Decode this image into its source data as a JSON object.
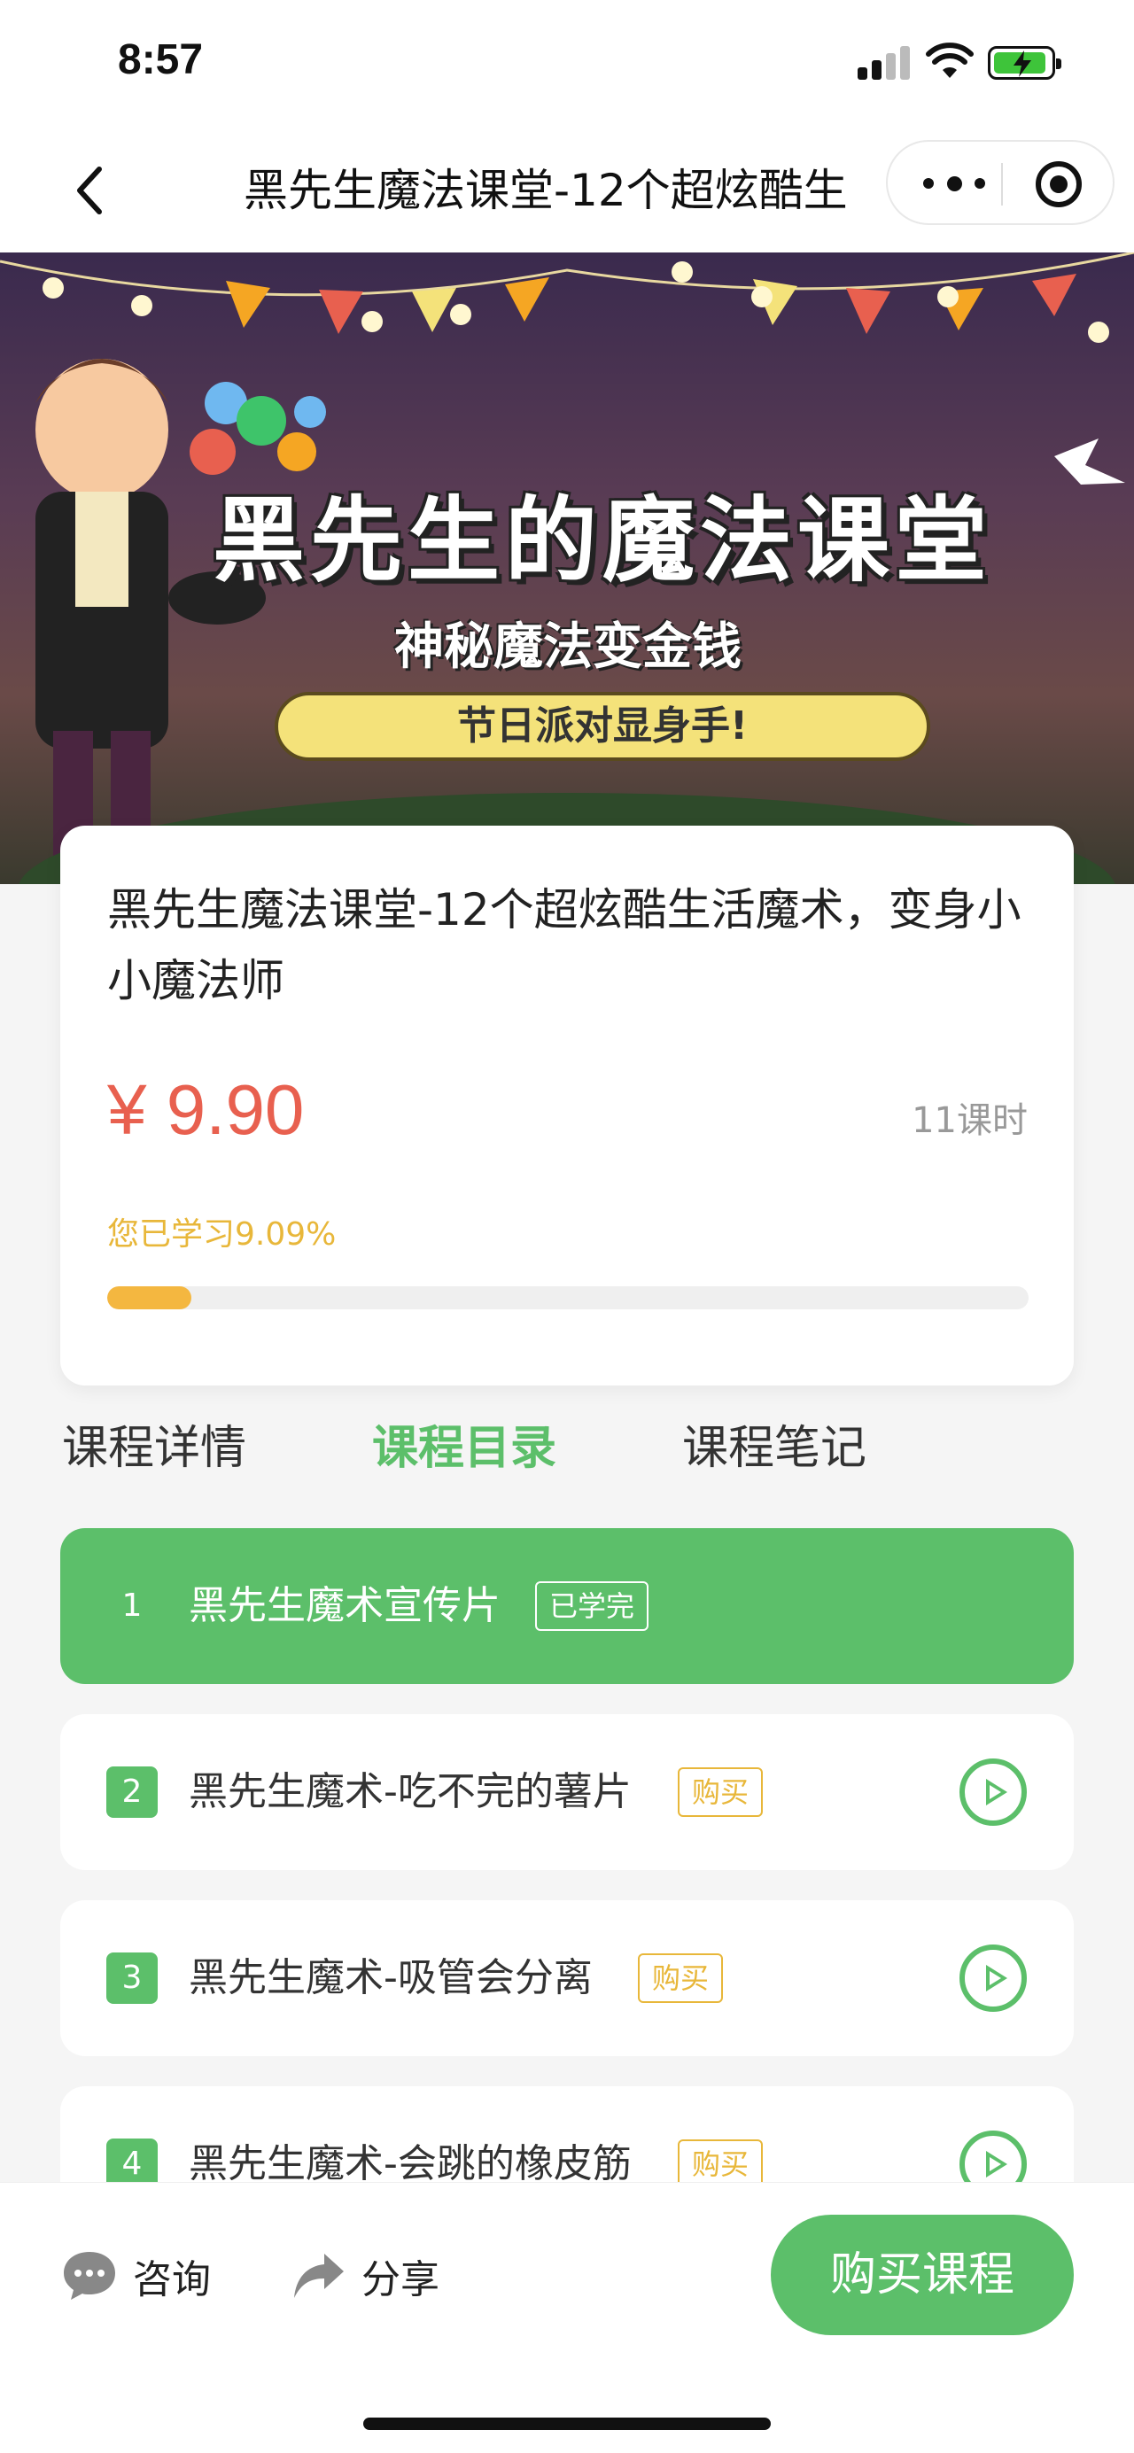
{
  "status_bar": {
    "time": "8:57"
  },
  "nav": {
    "title": "黑先生魔法课堂-12个超炫酷生"
  },
  "banner": {
    "title": "黑先生的魔法课堂",
    "subtitle": "神秘魔法变金钱",
    "pill": "节日派对显身手!"
  },
  "course": {
    "title": "黑先生魔法课堂-12个超炫酷生活魔术，变身小小魔法师",
    "price": "¥ 9.90",
    "lessons": "11课时",
    "progress_text": "您已学习9.09%",
    "progress_fraction": 0.0909
  },
  "tabs": [
    {
      "label": "课程详情",
      "active": false
    },
    {
      "label": "课程目录",
      "active": true
    },
    {
      "label": "课程笔记",
      "active": false
    }
  ],
  "lesson_list": [
    {
      "num": "1",
      "name": "黑先生魔术宣传片",
      "tag": "已学完",
      "active": true
    },
    {
      "num": "2",
      "name": "黑先生魔术-吃不完的薯片",
      "tag": "购买",
      "active": false
    },
    {
      "num": "3",
      "name": "黑先生魔术-吸管会分离",
      "tag": "购买",
      "active": false
    },
    {
      "num": "4",
      "name": "黑先生魔术-会跳的橡皮筋",
      "tag": "购买",
      "active": false
    }
  ],
  "bottom": {
    "consult": "咨询",
    "share": "分享",
    "buy": "购买课程"
  },
  "colors": {
    "accent": "#5cbf6a",
    "price": "#e8604f",
    "progress": "#f4b740",
    "tag": "#e8b73a"
  }
}
